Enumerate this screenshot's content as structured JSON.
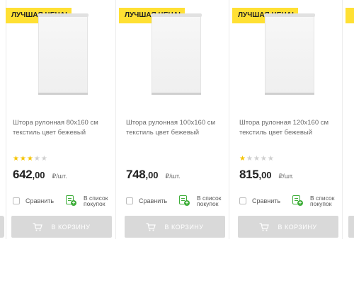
{
  "colors": {
    "badge_bg": "#ffe033",
    "star_on": "#f5c400",
    "star_off": "#cfcfcf",
    "list_icon": "#3fae3a",
    "cart_button_bg": "#d9d9d9"
  },
  "products": [
    {
      "badge": "ЛУЧШАЯ ЦЕНА!",
      "title": "Штора рулонная 80х160 см текстиль цвет бежевый",
      "rating": 3,
      "price_int": "642",
      "price_dec": ",00",
      "unit": "₽/шт.",
      "compare_label": "Сравнить",
      "list_label": "В список покупок",
      "cart_label": "В КОРЗИНУ",
      "icons": [
        "curtain-image",
        "list-add-icon",
        "cart-icon"
      ]
    },
    {
      "badge": "ЛУЧШАЯ ЦЕНА!",
      "title": "Штора рулонная 100х160 см текстиль цвет бежевый",
      "rating": 0,
      "price_int": "748",
      "price_dec": ",00",
      "unit": "₽/шт.",
      "compare_label": "Сравнить",
      "list_label": "В список покупок",
      "cart_label": "В КОРЗИНУ",
      "icons": [
        "curtain-image",
        "list-add-icon",
        "cart-icon"
      ]
    },
    {
      "badge": "ЛУЧШАЯ ЦЕНА!",
      "title": "Штора рулонная 120х160 см текстиль цвет бежевый",
      "rating": 1,
      "price_int": "815",
      "price_dec": ",00",
      "unit": "₽/шт.",
      "compare_label": "Сравнить",
      "list_label": "В список покупок",
      "cart_label": "В КОРЗИНУ",
      "icons": [
        "curtain-image",
        "list-add-icon",
        "cart-icon"
      ]
    }
  ]
}
